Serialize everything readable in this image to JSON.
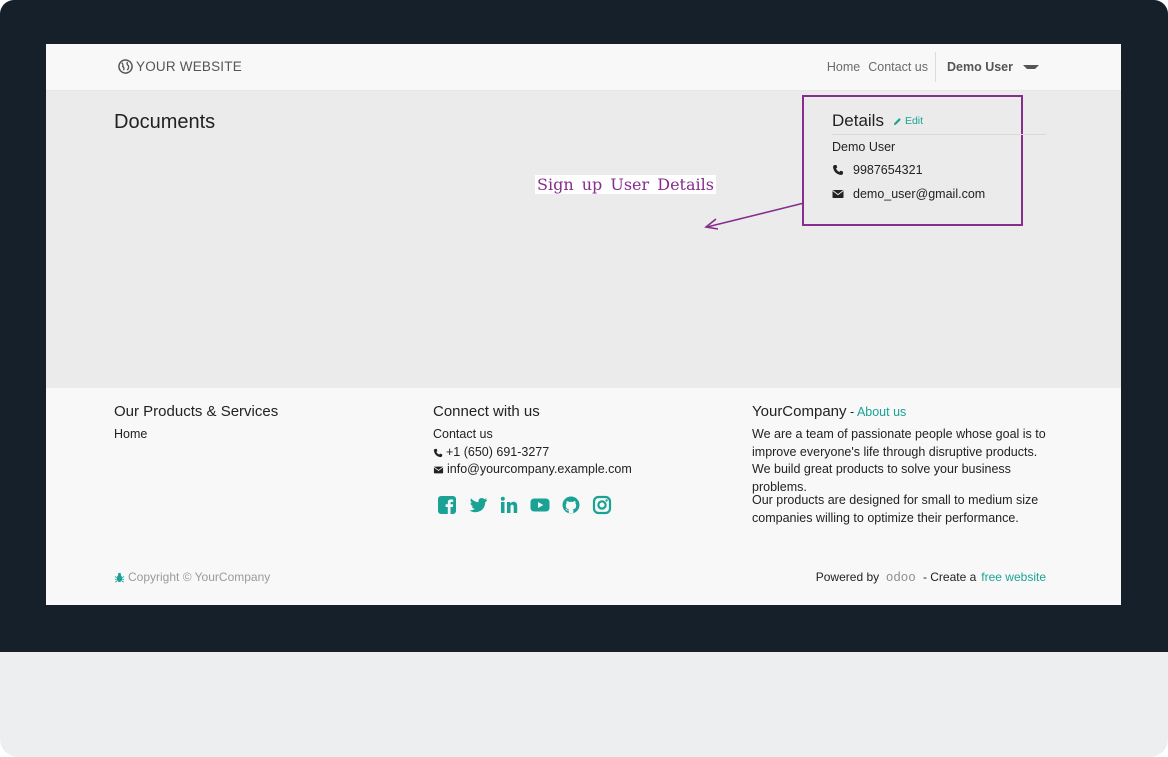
{
  "navbar": {
    "brand": "YOUR WEBSITE",
    "links": [
      "Home",
      "Contact us"
    ],
    "user": "Demo User"
  },
  "main": {
    "title": "Documents"
  },
  "details": {
    "title": "Details",
    "edit_label": "Edit",
    "name": "Demo User",
    "phone": "9987654321",
    "email": "demo_user@gmail.com"
  },
  "annotation": {
    "label": "Sign up User Details",
    "color": "#862d8d"
  },
  "footer": {
    "col1": {
      "title": "Our Products & Services",
      "link": "Home"
    },
    "col2": {
      "title": "Connect with us",
      "link": "Contact us",
      "phone": "+1 (650) 691-3277",
      "email": "info@yourcompany.example.com",
      "social_icons": [
        "facebook-icon",
        "twitter-icon",
        "linkedin-icon",
        "youtube-icon",
        "github-icon",
        "instagram-icon"
      ]
    },
    "col3": {
      "title": "YourCompany",
      "separator": " - ",
      "link": "About us",
      "para1": "We are a team of passionate people whose goal is to improve everyone's life through disruptive products. We build great products to solve your business problems.",
      "para2": "Our products are designed for small to medium size companies willing to optimize their performance."
    },
    "copyright": "Copyright © YourCompany",
    "powered_by": "Powered by",
    "odoo": "odoo",
    "create_text": "- Create a",
    "free_website": "free website"
  },
  "colors": {
    "accent": "#1aa395",
    "bezel": "#16202a",
    "annotation": "#862d8d"
  }
}
